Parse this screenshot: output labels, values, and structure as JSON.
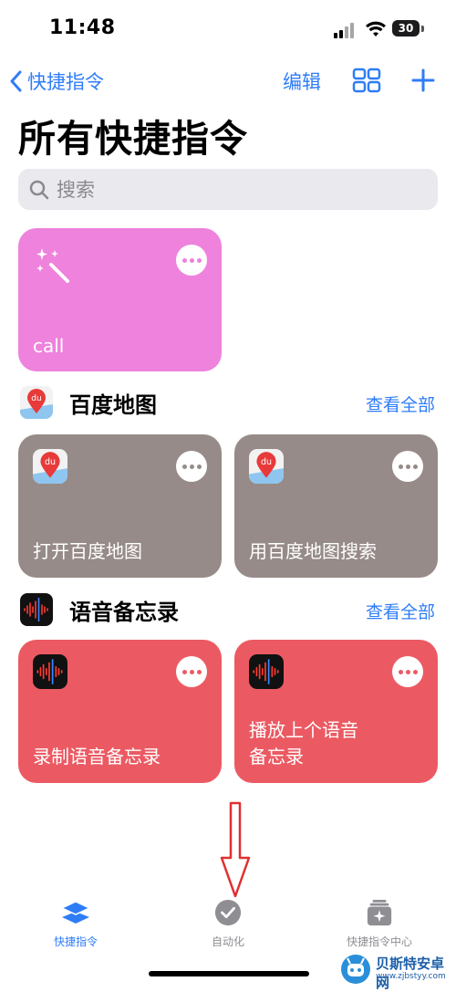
{
  "status_bar": {
    "time": "11:48",
    "battery": "30"
  },
  "nav": {
    "back_label": "快捷指令",
    "edit_label": "编辑"
  },
  "page_title": "所有快捷指令",
  "search": {
    "placeholder": "搜索"
  },
  "top_card": {
    "title": "call",
    "color": "#ee82dd",
    "icon": "magic-wand-icon"
  },
  "sections": [
    {
      "title": "百度地图",
      "view_all": "查看全部",
      "icon": "baidu-map-icon",
      "cards": [
        {
          "title": "打开百度地图",
          "color": "#968b88"
        },
        {
          "title": "用百度地图搜索",
          "color": "#968b88"
        }
      ]
    },
    {
      "title": "语音备忘录",
      "view_all": "查看全部",
      "icon": "voice-memo-icon",
      "cards": [
        {
          "title": "录制语音备忘录",
          "color": "#eb5a63"
        },
        {
          "title_line1": "播放上个语音",
          "title_line2": "备忘录",
          "color": "#eb5a63"
        }
      ]
    }
  ],
  "tab_bar": {
    "tabs": [
      {
        "label": "快捷指令",
        "icon": "layers-icon",
        "active": true
      },
      {
        "label": "自动化",
        "icon": "clock-check-icon",
        "active": false
      },
      {
        "label": "快捷指令中心",
        "icon": "gallery-icon",
        "active": false
      }
    ]
  },
  "watermark": {
    "title": "贝斯特安卓网",
    "url": "www.zjbstyy.com"
  },
  "colors": {
    "accent": "#2f7df6",
    "arrow": "#e03030"
  }
}
